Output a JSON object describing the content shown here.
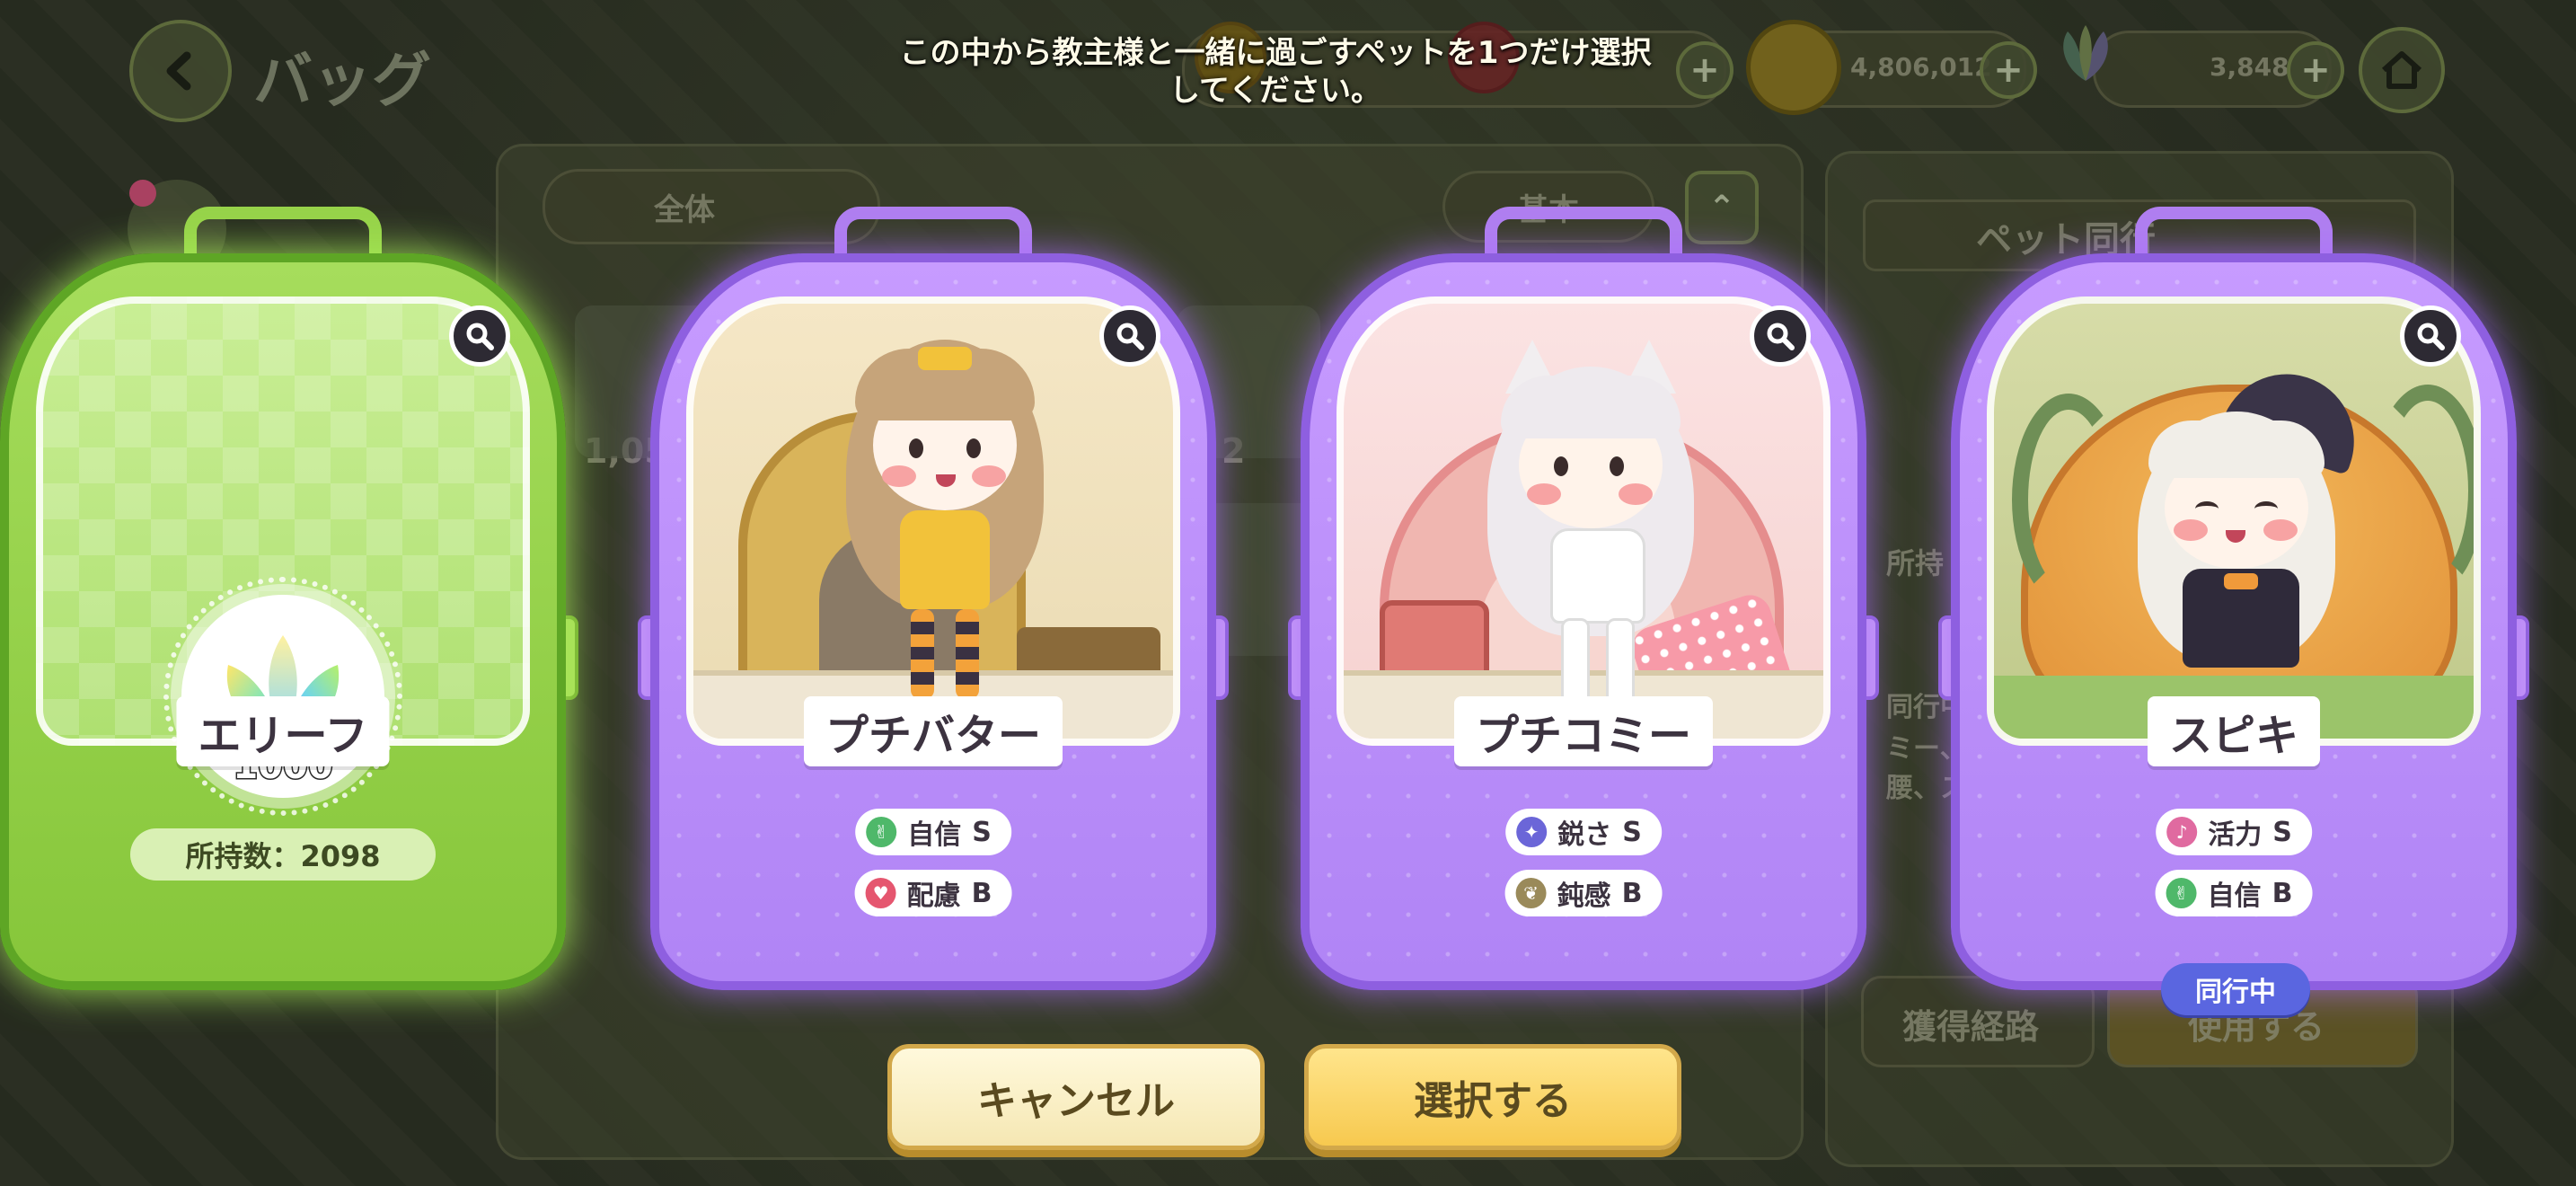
{
  "header": {
    "title": "バッグ",
    "back_icon": "chevron-left-icon",
    "home_icon": "home-icon",
    "currencies": [
      {
        "name": "gold-coin",
        "value": "4,806,012"
      },
      {
        "name": "leaf-gem",
        "value": "3,848"
      }
    ]
  },
  "background": {
    "filter_label": "全体",
    "sort_label": "基本",
    "side_panel_title": "ペット同行",
    "side_panel_lines": [
      "所持",
      "同行中",
      "ミー、",
      "腰、ス"
    ],
    "item_counts": [
      "1,05",
      "2"
    ],
    "buttons": {
      "acquire": "獲得経路",
      "use": "使用する"
    }
  },
  "instruction": {
    "line1": "この中から教主様と一緒に過ごすペットを1つだけ選択",
    "line2": "してください。"
  },
  "cards": [
    {
      "name": "エリーフ",
      "theme": "green",
      "icon_value": "1000",
      "owned_label": "所持数：2098"
    },
    {
      "name": "プチバター",
      "theme": "purple",
      "stats": [
        {
          "label": "自信",
          "rank": "S",
          "icon": "peace-sign-icon",
          "color": "#4fb86a"
        },
        {
          "label": "配慮",
          "rank": "B",
          "icon": "heart-icon",
          "color": "#e5566f"
        }
      ]
    },
    {
      "name": "プチコミー",
      "theme": "purple",
      "stats": [
        {
          "label": "鋭さ",
          "rank": "S",
          "icon": "sparkle-icon",
          "color": "#6b66d8"
        },
        {
          "label": "鈍感",
          "rank": "B",
          "icon": "sprout-icon",
          "color": "#9a8a5a"
        }
      ]
    },
    {
      "name": "スピキ",
      "theme": "purple",
      "active_label": "同行中",
      "stats": [
        {
          "label": "活力",
          "rank": "S",
          "icon": "music-note-icon",
          "color": "#e06aa0"
        },
        {
          "label": "自信",
          "rank": "B",
          "icon": "peace-sign-icon",
          "color": "#4fb86a"
        }
      ]
    }
  ],
  "buttons": {
    "cancel": "キャンセル",
    "select": "選択する"
  }
}
